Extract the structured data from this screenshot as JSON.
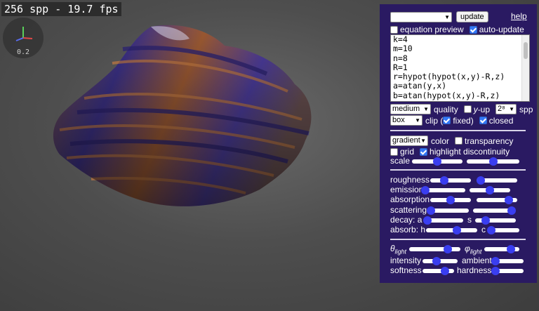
{
  "overlay": {
    "fps_text": "256 spp - 19.7 fps",
    "gizmo_scale": "0.2"
  },
  "panel": {
    "equation_select_value": "",
    "update_label": "update",
    "help_label": "help",
    "equation_preview_label": "equation preview",
    "equation_preview_checked": false,
    "auto_update_label": "auto-update",
    "auto_update_checked": true,
    "code_lines": [
      "k=4",
      "m=10",
      "n=8",
      "R=1",
      "r=hypot(hypot(x,y)-R,z)",
      "a=atan(y,x)",
      "b=atan(hypot(x,y)-R,z)"
    ],
    "quality_value": "medium",
    "quality_label": "quality",
    "y_prefix": "y",
    "y_up_suffix": "-up",
    "y_up_checked": false,
    "spp_value": "2⁸",
    "spp_label": "spp",
    "clip_value": "box",
    "clip_label": "clip (",
    "fixed_label": "fixed)",
    "fixed_checked": true,
    "closed_label": "closed",
    "closed_checked": true,
    "color_mode_value": "gradient",
    "color_label": "color",
    "transparency_label": "transparency",
    "transparency_checked": false,
    "grid_label": "grid",
    "grid_checked": false,
    "highlight_label": "highlight discontinuity",
    "highlight_checked": true,
    "scale_label": "scale",
    "roughness_label": "roughness",
    "emission_label": "emission",
    "absorption_label": "absorption",
    "scattering_label": "scattering",
    "decay_label": "decay: a",
    "decay_s_label": "s",
    "absorb_label": "absorb: h",
    "absorb_c_label": "c",
    "theta_symbol": "θ",
    "phi_symbol": "φ",
    "light_sub": "light",
    "intensity_label": "intensity",
    "ambient_label": "ambient",
    "softness_label": "softness",
    "hardness_label": "hardness"
  },
  "sliders": {
    "scale_1": 0.5,
    "scale_2": 0.5,
    "roughness_1": 0.35,
    "roughness_2": 0.1,
    "emission_1": 0.02,
    "emission_2": 0.5,
    "absorption_1": 0.5,
    "absorption_2": 0.8,
    "scattering_1": 0.02,
    "scattering_2": 0.95,
    "decay_a": 0.08,
    "decay_s": 0.25,
    "absorb_h": 0.6,
    "absorb_c": 0.05,
    "theta_light": 0.75,
    "phi_light": 0.75,
    "intensity": 0.4,
    "ambient": 0.05,
    "softness": 0.7,
    "hardness": 0.05
  },
  "colors": {
    "panel_bg": "#2a1a62",
    "slider_knob": "#3a3ef0",
    "accent_check": "#3478f6"
  }
}
